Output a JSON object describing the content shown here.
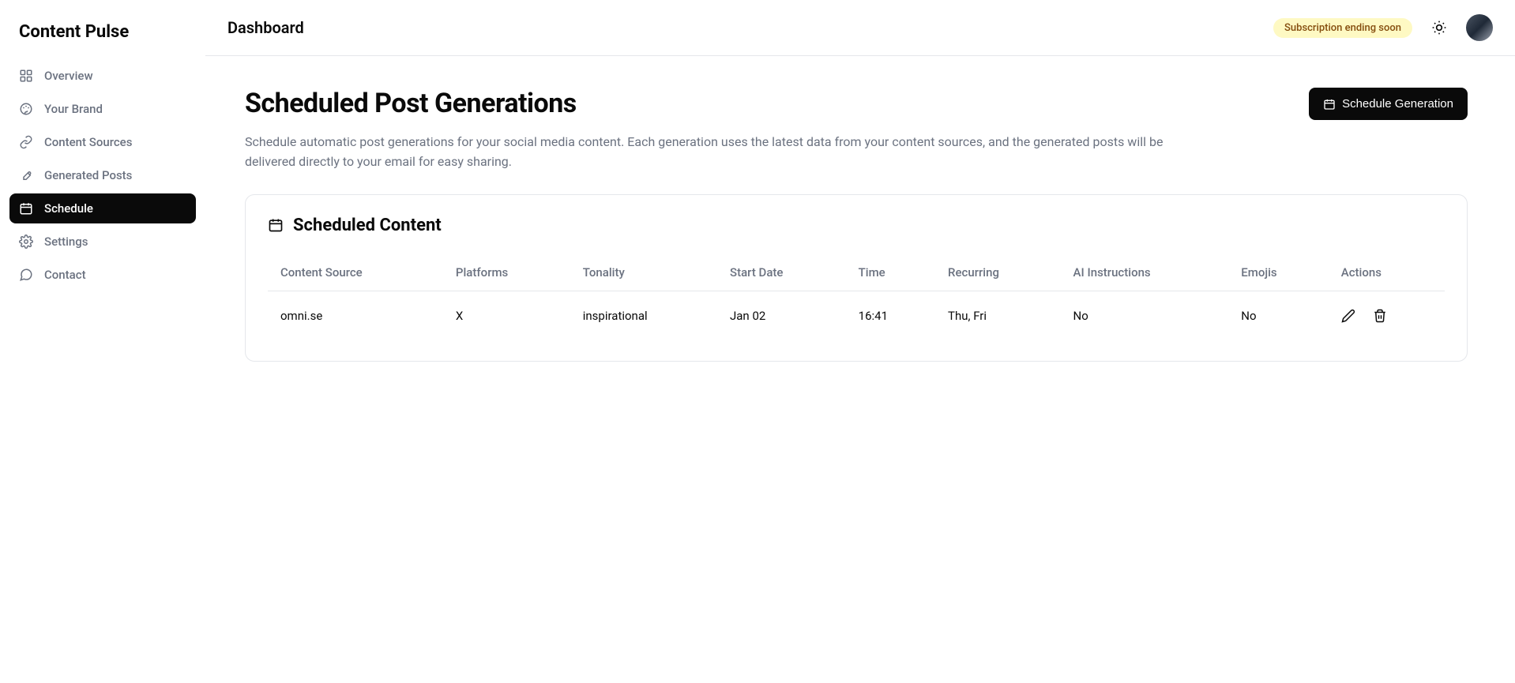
{
  "brand": "Content Pulse",
  "header": {
    "title": "Dashboard",
    "subscription_badge": "Subscription ending soon"
  },
  "sidebar": {
    "items": [
      {
        "label": "Overview",
        "icon": "dashboard-icon",
        "active": false
      },
      {
        "label": "Your Brand",
        "icon": "palette-icon",
        "active": false
      },
      {
        "label": "Content Sources",
        "icon": "link-icon",
        "active": false
      },
      {
        "label": "Generated Posts",
        "icon": "pen-icon",
        "active": false
      },
      {
        "label": "Schedule",
        "icon": "calendar-icon",
        "active": true
      },
      {
        "label": "Settings",
        "icon": "gear-icon",
        "active": false
      },
      {
        "label": "Contact",
        "icon": "chat-icon",
        "active": false
      }
    ]
  },
  "page": {
    "title": "Scheduled Post Generations",
    "action_button": "Schedule Generation",
    "description": "Schedule automatic post generations for your social media content. Each generation uses the latest data from your content sources, and the generated posts will be delivered directly to your email for easy sharing."
  },
  "card": {
    "title": "Scheduled Content",
    "columns": [
      "Content Source",
      "Platforms",
      "Tonality",
      "Start Date",
      "Time",
      "Recurring",
      "AI Instructions",
      "Emojis",
      "Actions"
    ],
    "rows": [
      {
        "content_source": "omni.se",
        "platforms": "X",
        "tonality": "inspirational",
        "start_date": "Jan 02",
        "time": "16:41",
        "recurring": "Thu, Fri",
        "ai_instructions": "No",
        "emojis": "No"
      }
    ]
  }
}
